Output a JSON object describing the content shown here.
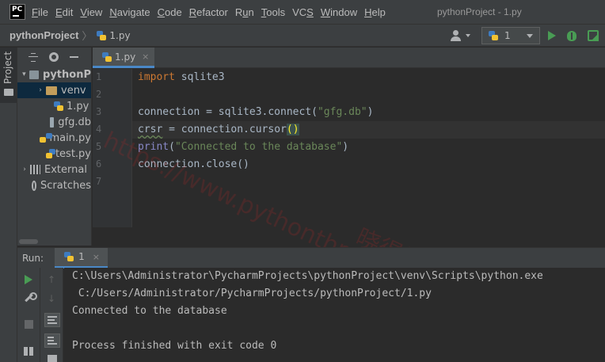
{
  "menubar": {
    "logo": "PC",
    "items": [
      {
        "label": "File",
        "mnemonic": "F",
        "rest": "ile"
      },
      {
        "label": "Edit",
        "mnemonic": "E",
        "rest": "dit"
      },
      {
        "label": "View",
        "mnemonic": "V",
        "rest": "iew"
      },
      {
        "label": "Navigate",
        "mnemonic": "N",
        "rest": "avigate"
      },
      {
        "label": "Code",
        "mnemonic": "C",
        "rest": "ode"
      },
      {
        "label": "Refactor",
        "mnemonic": "R",
        "rest": "efactor"
      },
      {
        "label": "Run",
        "mnemonic": "u",
        "pre": "R",
        "rest": "n"
      },
      {
        "label": "Tools",
        "mnemonic": "T",
        "rest": "ools"
      },
      {
        "label": "VCS",
        "mnemonic": "S",
        "pre": "VC",
        "rest": ""
      },
      {
        "label": "Window",
        "mnemonic": "W",
        "rest": "indow"
      },
      {
        "label": "Help",
        "mnemonic": "H",
        "rest": "elp"
      }
    ],
    "window_title": "pythonProject - 1.py"
  },
  "navbar": {
    "project": "pythonProject",
    "separator": "〉",
    "file": "1.py",
    "run_config": "1",
    "icons": [
      "user-icon",
      "python-icon",
      "play-icon",
      "bug-icon",
      "coverage-icon"
    ]
  },
  "left_stripe": {
    "tab_label": "Project"
  },
  "project_tree": {
    "items": [
      {
        "label": "pythonP",
        "arrow": "▾",
        "icon": "folder-icon",
        "bold": true,
        "indent": 4,
        "selected": false
      },
      {
        "label": "venv",
        "arrow": "›",
        "icon": "folder-icon",
        "indent": 24,
        "selected": true
      },
      {
        "label": "1.py",
        "arrow": "",
        "icon": "python-file-icon",
        "indent": 34,
        "selected": false
      },
      {
        "label": "gfg.db",
        "arrow": "",
        "icon": "file-icon",
        "indent": 34,
        "selected": false
      },
      {
        "label": "main.py",
        "arrow": "",
        "icon": "python-file-icon",
        "indent": 34,
        "selected": false
      },
      {
        "label": "test.py",
        "arrow": "",
        "icon": "python-file-icon",
        "indent": 34,
        "selected": false
      },
      {
        "label": "External",
        "arrow": "›",
        "icon": "library-icon",
        "indent": 4,
        "selected": false
      },
      {
        "label": "Scratches",
        "arrow": "",
        "icon": "scratch-icon",
        "indent": 14,
        "selected": false
      }
    ]
  },
  "editor": {
    "tab_label": "1.py",
    "tab_close": "×",
    "line_numbers": [
      "1",
      "2",
      "3",
      "4",
      "5",
      "6",
      "7"
    ],
    "lines": [
      {
        "segments": [
          {
            "text": "import",
            "cls": "kw"
          },
          {
            "text": " sqlite3",
            "cls": ""
          }
        ]
      },
      {
        "segments": []
      },
      {
        "segments": [
          {
            "text": "connection = sqlite3.connect(",
            "cls": ""
          },
          {
            "text": "\"gfg.db\"",
            "cls": "str"
          },
          {
            "text": ")",
            "cls": ""
          }
        ]
      },
      {
        "segments": [
          {
            "text": "crsr",
            "cls": "squiggle"
          },
          {
            "text": " = connection.cursor",
            "cls": ""
          },
          {
            "text": "(",
            "cls": "paren-match"
          },
          {
            "text": ")",
            "cls": "paren-match"
          }
        ]
      },
      {
        "segments": [
          {
            "text": "print",
            "cls": "bi"
          },
          {
            "text": "(",
            "cls": ""
          },
          {
            "text": "\"Connected to the database\"",
            "cls": "str"
          },
          {
            "text": ")",
            "cls": ""
          }
        ]
      },
      {
        "segments": [
          {
            "text": "connection.close()",
            "cls": ""
          }
        ]
      },
      {
        "segments": []
      }
    ],
    "current_line": 4
  },
  "watermark": {
    "text": "https://www.pythonthree.com",
    "text_cn": "晓得博客"
  },
  "run_panel": {
    "title": "Run:",
    "tab_label": "1",
    "tab_close": "×",
    "output": [
      "C:\\Users\\Administrator\\PycharmProjects\\pythonProject\\venv\\Scripts\\python.exe",
      " C:/Users/Administrator/PycharmProjects/pythonProject/1.py",
      "Connected to the database",
      "",
      "Process finished with exit code 0"
    ]
  }
}
